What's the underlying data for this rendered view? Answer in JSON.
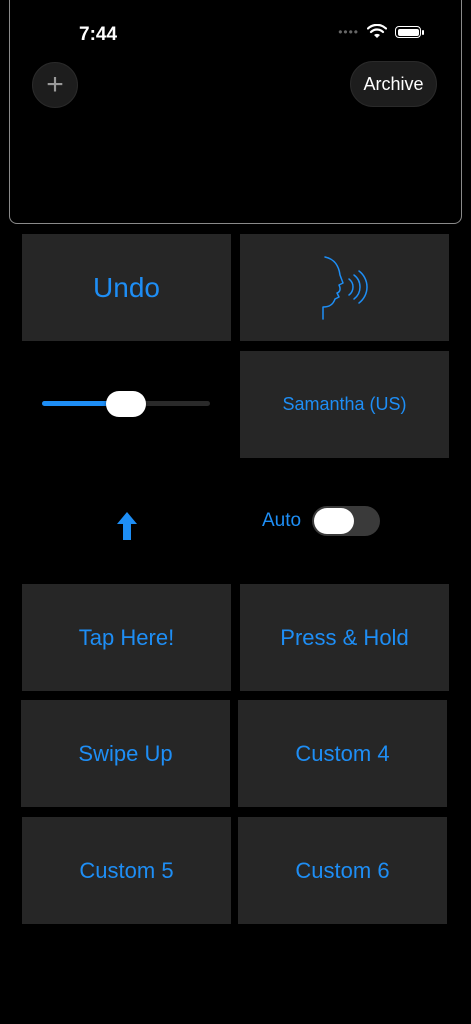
{
  "status_bar": {
    "time": "7:44"
  },
  "top_panel": {
    "archive_label": "Archive",
    "plus_symbol": "+"
  },
  "controls": {
    "undo_label": "Undo",
    "voice_label": "Samantha (US)",
    "speech_rate_fraction": 0.5,
    "auto_label": "Auto",
    "auto_enabled": false
  },
  "buttons": {
    "b1": "Tap Here!",
    "b2": "Press & Hold",
    "b3": "Swipe Up",
    "b4": "Custom 4",
    "b5": "Custom 5",
    "b6": "Custom 6"
  },
  "colors": {
    "accent": "#1e8ef5",
    "tile": "#262626",
    "background": "#000000"
  },
  "icons": [
    "plus-icon",
    "speak-head-icon",
    "up-arrow-icon",
    "wifi-icon",
    "battery-icon"
  ]
}
